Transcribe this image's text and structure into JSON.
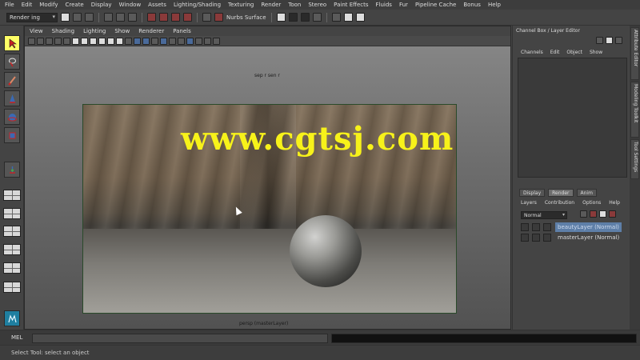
{
  "menubar": {
    "items": [
      "File",
      "Edit",
      "Modify",
      "Create",
      "Display",
      "Window",
      "Assets",
      "Lighting/Shading",
      "Texturing",
      "Render",
      "Toon",
      "Stereo",
      "Paint Effects",
      "Fluids",
      "Fur",
      "Pipeline Cache",
      "Bonus",
      "Help"
    ]
  },
  "statusline": {
    "mode": "Render ing",
    "nurbs_label": "Nurbs Surface"
  },
  "viewport": {
    "menu": [
      "View",
      "Shading",
      "Lighting",
      "Show",
      "Renderer",
      "Panels"
    ],
    "camera_label_top": "sep r sen r",
    "camera_label_bottom": "persp (masterLayer)",
    "watermark": "www.cgtsj.com"
  },
  "channel_box": {
    "title": "Channel Box / Layer Editor",
    "tabs": [
      "Channels",
      "Edit",
      "Object",
      "Show"
    ]
  },
  "layer_editor": {
    "tabs": [
      "Display",
      "Render",
      "Anim"
    ],
    "active_tab": "Render",
    "menu": [
      "Layers",
      "Contribution",
      "Options",
      "Help"
    ],
    "blend_mode": "Normal",
    "layers": [
      {
        "name": "beautyLayer (Normal)",
        "selected": true
      },
      {
        "name": "masterLayer (Normal)",
        "selected": false
      }
    ]
  },
  "vertical_tabs": [
    "Attribute Editor",
    "Modeling Toolkit",
    "Tool Settings"
  ],
  "command_line": {
    "label": "MEL",
    "value": ""
  },
  "help_line": {
    "text": "Select Tool: select an object"
  }
}
